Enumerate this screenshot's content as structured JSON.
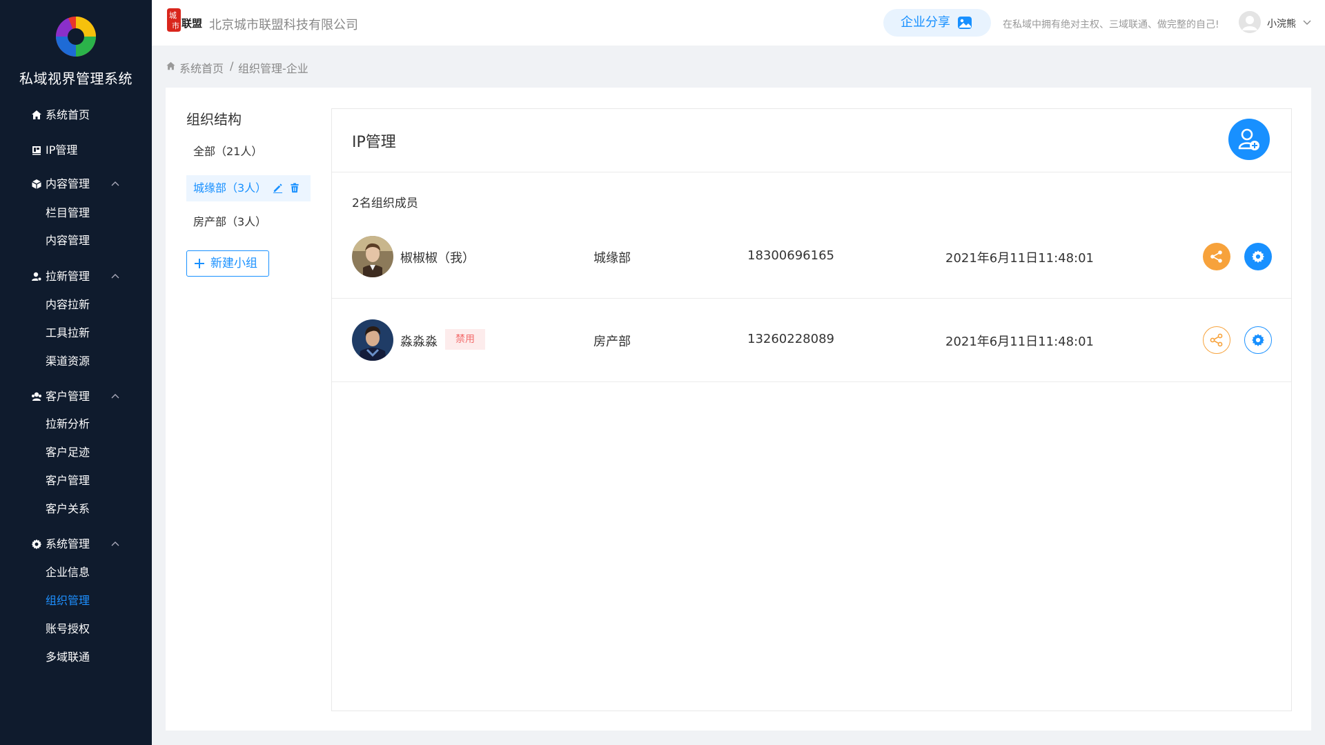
{
  "sidebar": {
    "system_title": "私域视界管理系统",
    "menu": [
      {
        "label": "系统首页",
        "icon": "home-icon"
      },
      {
        "label": "IP管理",
        "icon": "ip-icon"
      },
      {
        "label": "内容管理",
        "icon": "cube-icon",
        "children": [
          "栏目管理",
          "内容管理"
        ]
      },
      {
        "label": "拉新管理",
        "icon": "user-icon",
        "children": [
          "内容拉新",
          "工具拉新",
          "渠道资源"
        ]
      },
      {
        "label": "客户管理",
        "icon": "users-icon",
        "children": [
          "拉新分析",
          "客户足迹",
          "客户管理",
          "客户关系"
        ]
      },
      {
        "label": "系统管理",
        "icon": "gear-icon",
        "children": [
          "企业信息",
          "组织管理",
          "账号授权",
          "多域联通"
        ]
      }
    ],
    "active_item": "组织管理",
    "active_color": "#1e90ff",
    "bg_color": "#0f1b2d"
  },
  "header": {
    "brand_logo_text": [
      "城",
      "市",
      "联盟"
    ],
    "company_name": "北京城市联盟科技有限公司",
    "share_label": "企业分享",
    "slogan": "在私域中拥有绝对主权、三域联通、做完整的自己!",
    "user_name": "小浣熊"
  },
  "breadcrumb": {
    "home": "系统首页",
    "separator": "/",
    "current": "组织管理-企业"
  },
  "org": {
    "title": "组织结构",
    "items": [
      {
        "label": "全部（21人）"
      },
      {
        "label": "城缘部（3人）",
        "active": true
      },
      {
        "label": "房产部（3人）"
      }
    ],
    "new_group_label": "新建小组"
  },
  "ip": {
    "title": "IP管理",
    "member_count": "2名组织成员",
    "members": [
      {
        "name": "椒椒椒（我）",
        "badge": "",
        "dept": "城缘部",
        "phone": "18300696165",
        "time": "2021年6月11日11:48:01",
        "style": "filled"
      },
      {
        "name": "淼淼淼",
        "badge": "禁用",
        "dept": "房产部",
        "phone": "13260228089",
        "time": "2021年6月11日11:48:01",
        "style": "outlined"
      }
    ]
  },
  "colors": {
    "primary": "#1890ff",
    "orange": "#f7a23b",
    "badge_red": "#f36d6d"
  }
}
